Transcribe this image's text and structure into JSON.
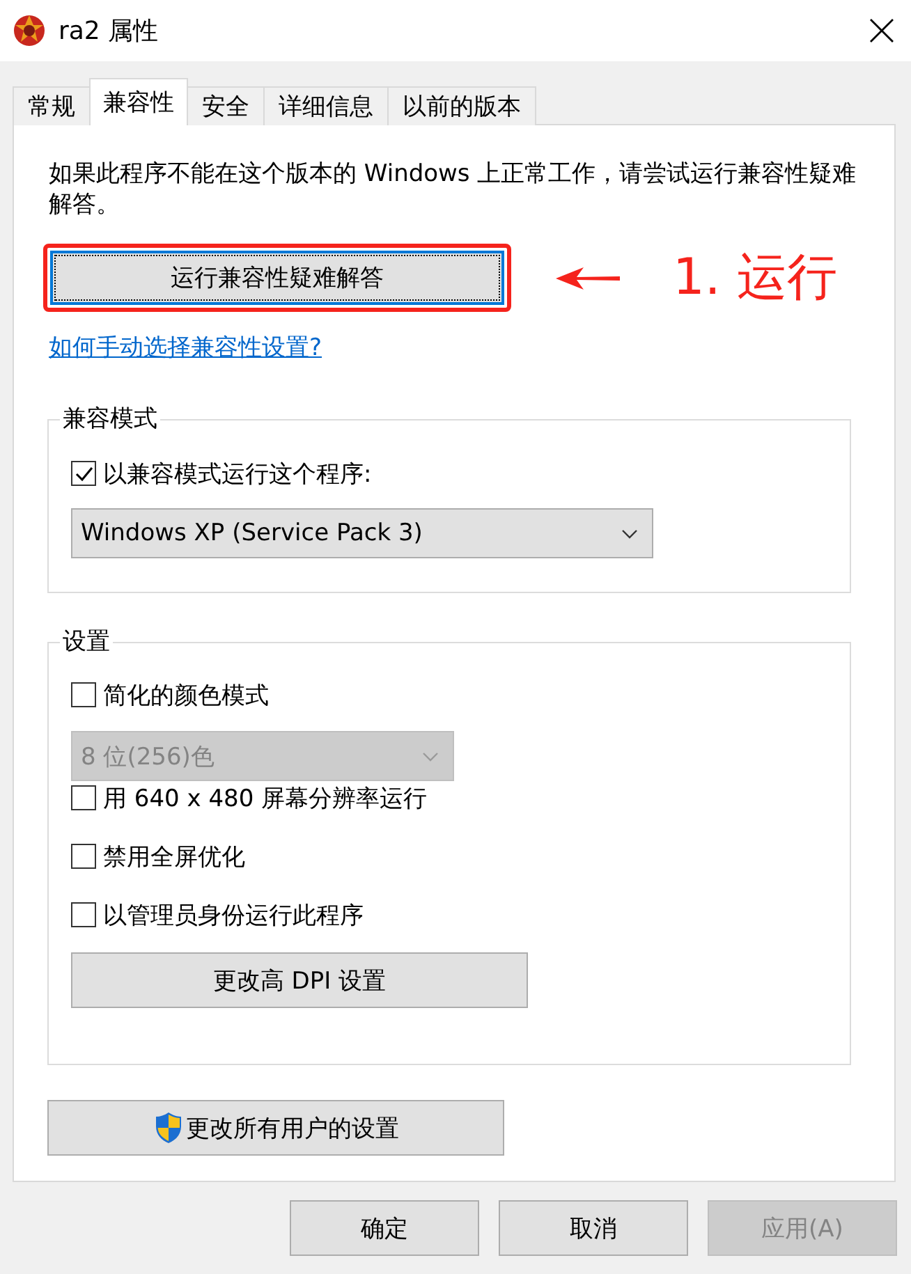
{
  "window": {
    "title": "ra2 属性"
  },
  "tabs": [
    {
      "label": "常规",
      "selected": false
    },
    {
      "label": "兼容性",
      "selected": true
    },
    {
      "label": "安全",
      "selected": false
    },
    {
      "label": "详细信息",
      "selected": false
    },
    {
      "label": "以前的版本",
      "selected": false
    }
  ],
  "intro": "如果此程序不能在这个版本的 Windows 上正常工作，请尝试运行兼容性疑难解答。",
  "troubleshoot_button": {
    "label": "运行兼容性疑难解答"
  },
  "annotation": {
    "text": "1. 运行"
  },
  "help_link": "如何手动选择兼容性设置?",
  "compat_mode": {
    "title": "兼容模式",
    "checkbox": {
      "label": "以兼容模式运行这个程序:",
      "checked": true
    },
    "dropdown": {
      "value": "Windows XP (Service Pack 3)",
      "disabled": false
    }
  },
  "settings": {
    "title": "设置",
    "items": [
      {
        "kind": "checkbox",
        "label": "简化的颜色模式",
        "checked": false
      },
      {
        "kind": "dropdown",
        "value": "8 位(256)色",
        "disabled": true
      },
      {
        "kind": "checkbox",
        "label": "用 640 x 480 屏幕分辨率运行",
        "checked": false
      },
      {
        "kind": "checkbox",
        "label": "禁用全屏优化",
        "checked": false
      },
      {
        "kind": "checkbox",
        "label": "以管理员身份运行此程序",
        "checked": false
      },
      {
        "kind": "button",
        "label": "更改高 DPI 设置"
      }
    ]
  },
  "all_users_button": {
    "label": "更改所有用户的设置"
  },
  "footer_buttons": [
    {
      "label": "确定",
      "disabled": false
    },
    {
      "label": "取消",
      "disabled": false
    },
    {
      "label": "应用(A)",
      "disabled": true
    }
  ]
}
